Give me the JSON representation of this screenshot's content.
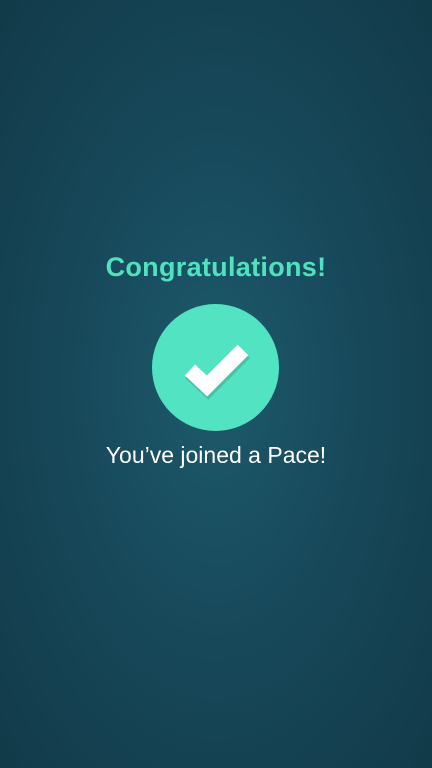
{
  "confirmation": {
    "title": "Congratulations!",
    "message": "You’ve joined a Pace!",
    "icon": "checkmark-icon"
  },
  "colors": {
    "background": "#17495b",
    "accent": "#4fe2c0",
    "badge": "#52e4c2",
    "message_text": "#ffffff"
  }
}
